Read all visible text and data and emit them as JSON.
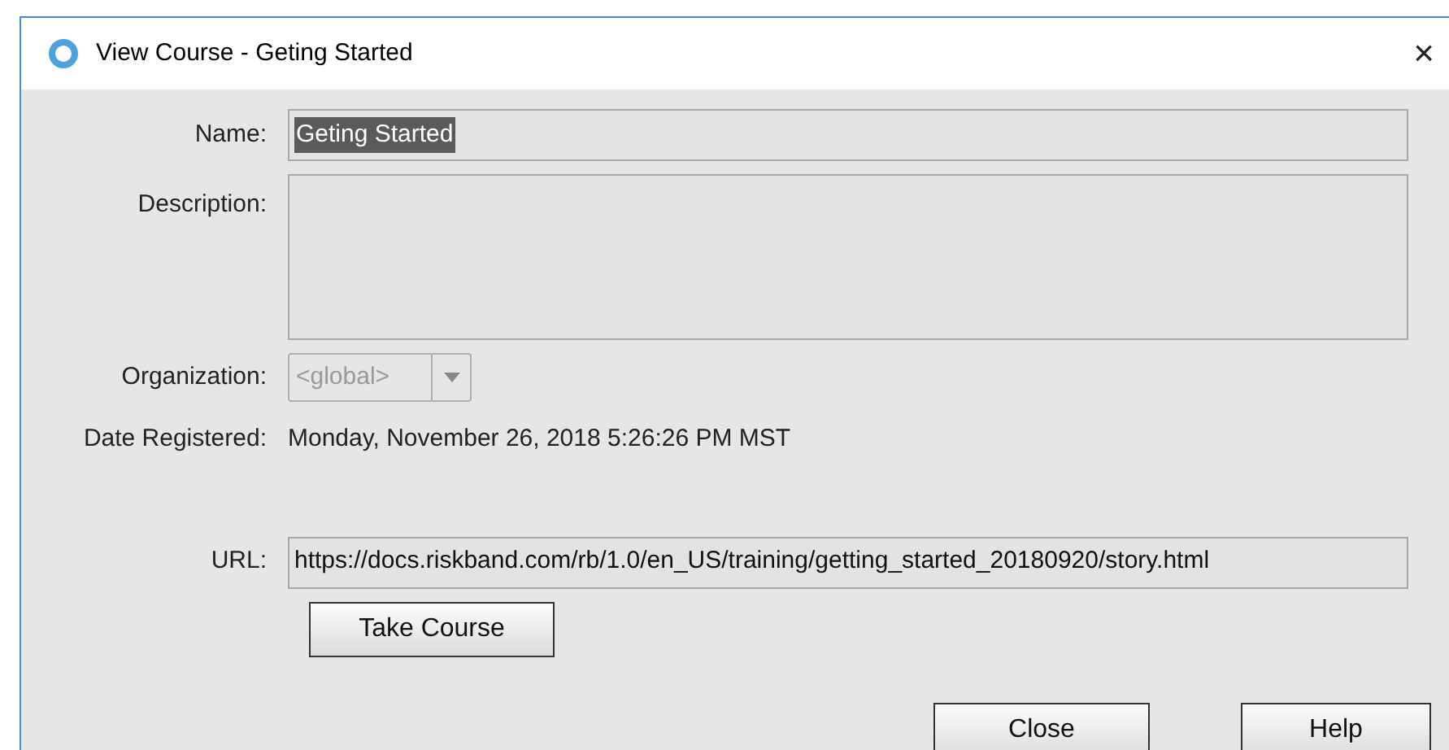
{
  "window": {
    "title": "View Course - Geting Started",
    "close": "×"
  },
  "fields": [
    {
      "label": "Name:",
      "kind": "text",
      "value": "Geting Started",
      "selected": true
    },
    {
      "label": "Description:",
      "kind": "textarea"
    },
    {
      "label": "Organization:",
      "kind": "combo",
      "value": "<global>",
      "disabled": true
    },
    {
      "label": "Date Registered:",
      "kind": "static",
      "value": "Monday, November 26, 2018 5:26:26 PM MST"
    },
    {
      "label": "URL:",
      "kind": "text",
      "value": "https://docs.riskband.com/rb/1.0/en_US/training/getting_started_20180920/story.html",
      "selected": false
    }
  ],
  "take_course_button": "Take Course",
  "buttons": [
    "Close",
    "Help"
  ]
}
